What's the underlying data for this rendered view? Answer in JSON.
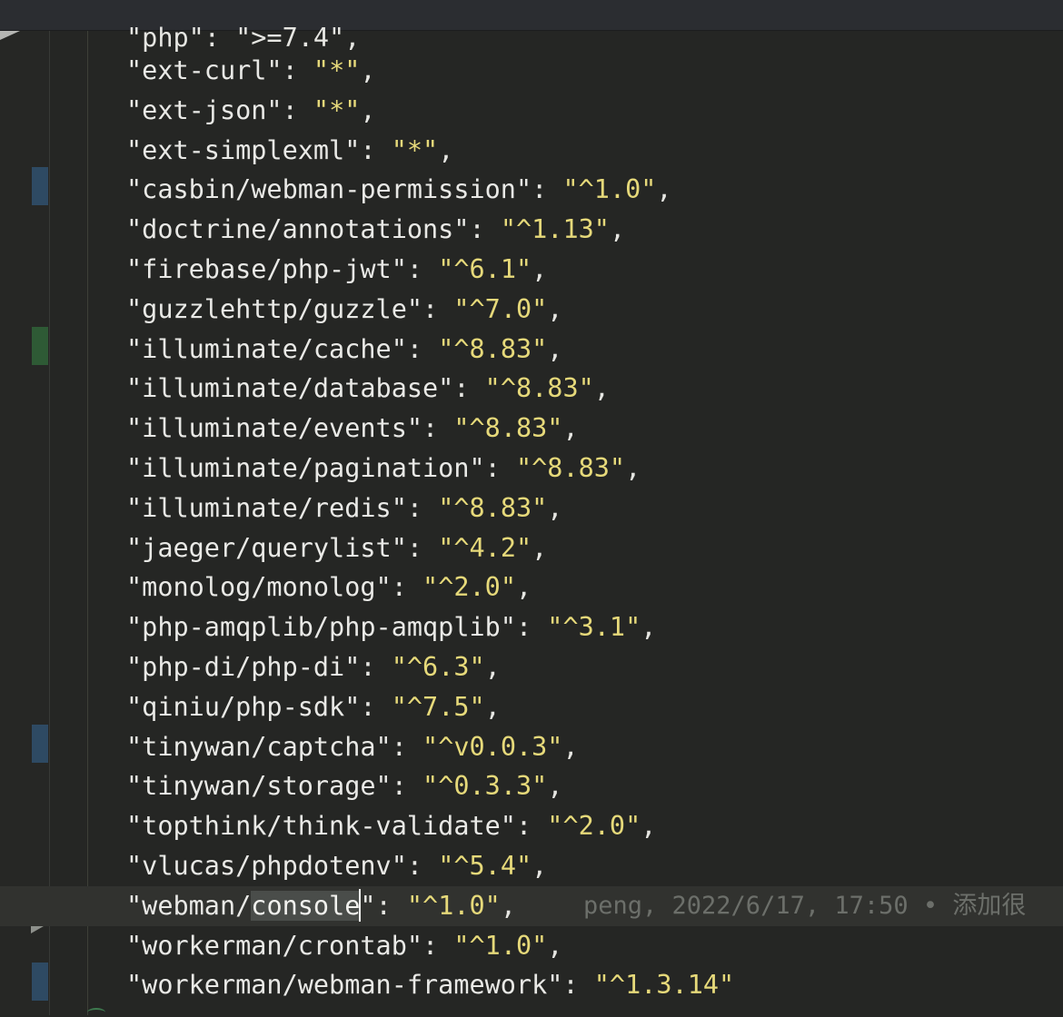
{
  "editor": {
    "partial_line": "\"php\": \">=7.4\",",
    "lines": [
      {
        "key": "\"ext-curl\"",
        "value": "\"*\"",
        "tail": ","
      },
      {
        "key": "\"ext-json\"",
        "value": "\"*\"",
        "tail": ","
      },
      {
        "key": "\"ext-simplexml\"",
        "value": "\"*\"",
        "tail": ","
      },
      {
        "key": "\"casbin/webman-permission\"",
        "value": "\"^1.0\"",
        "tail": ","
      },
      {
        "key": "\"doctrine/annotations\"",
        "value": "\"^1.13\"",
        "tail": ","
      },
      {
        "key": "\"firebase/php-jwt\"",
        "value": "\"^6.1\"",
        "tail": ","
      },
      {
        "key": "\"guzzlehttp/guzzle\"",
        "value": "\"^7.0\"",
        "tail": ","
      },
      {
        "key": "\"illuminate/cache\"",
        "value": "\"^8.83\"",
        "tail": ","
      },
      {
        "key": "\"illuminate/database\"",
        "value": "\"^8.83\"",
        "tail": ","
      },
      {
        "key": "\"illuminate/events\"",
        "value": "\"^8.83\"",
        "tail": ","
      },
      {
        "key": "\"illuminate/pagination\"",
        "value": "\"^8.83\"",
        "tail": ","
      },
      {
        "key": "\"illuminate/redis\"",
        "value": "\"^8.83\"",
        "tail": ","
      },
      {
        "key": "\"jaeger/querylist\"",
        "value": "\"^4.2\"",
        "tail": ","
      },
      {
        "key": "\"monolog/monolog\"",
        "value": "\"^2.0\"",
        "tail": ","
      },
      {
        "key": "\"php-amqplib/php-amqplib\"",
        "value": "\"^3.1\"",
        "tail": ","
      },
      {
        "key": "\"php-di/php-di\"",
        "value": "\"^6.3\"",
        "tail": ","
      },
      {
        "key": "\"qiniu/php-sdk\"",
        "value": "\"^7.5\"",
        "tail": ","
      },
      {
        "key": "\"tinywan/captcha\"",
        "value": "\"^v0.0.3\"",
        "tail": ","
      },
      {
        "key": "\"tinywan/storage\"",
        "value": "\"^0.3.3\"",
        "tail": ","
      },
      {
        "key": "\"topthink/think-validate\"",
        "value": "\"^2.0\"",
        "tail": ","
      },
      {
        "key": "\"vlucas/phpdotenv\"",
        "value": "\"^5.4\"",
        "tail": ","
      },
      {
        "key": "",
        "value": "\"^1.0\"",
        "tail": ",",
        "current": true
      },
      {
        "key": "\"workerman/crontab\"",
        "value": "\"^1.0\"",
        "tail": ","
      },
      {
        "key": "\"workerman/webman-framework\"",
        "value": "\"^1.3.14\"",
        "tail": ""
      }
    ],
    "current_line": {
      "key_prefix": "\"webman/",
      "key_selected": "console",
      "key_suffix": "\"",
      "blame": "peng, 2022/6/17, 17:50 • 添加很"
    }
  },
  "vcs_marks": [
    {
      "line": 3,
      "color": "#2e4a63"
    },
    {
      "line": 7,
      "color": "#2e5a35"
    },
    {
      "line": 17,
      "color": "#2e4a63"
    },
    {
      "line": 23,
      "color": "#2e4a63"
    }
  ],
  "colors": {
    "key": "#e9e9e6",
    "string": "#e6d97a",
    "blame": "#6c6f6a",
    "background": "#252624"
  }
}
